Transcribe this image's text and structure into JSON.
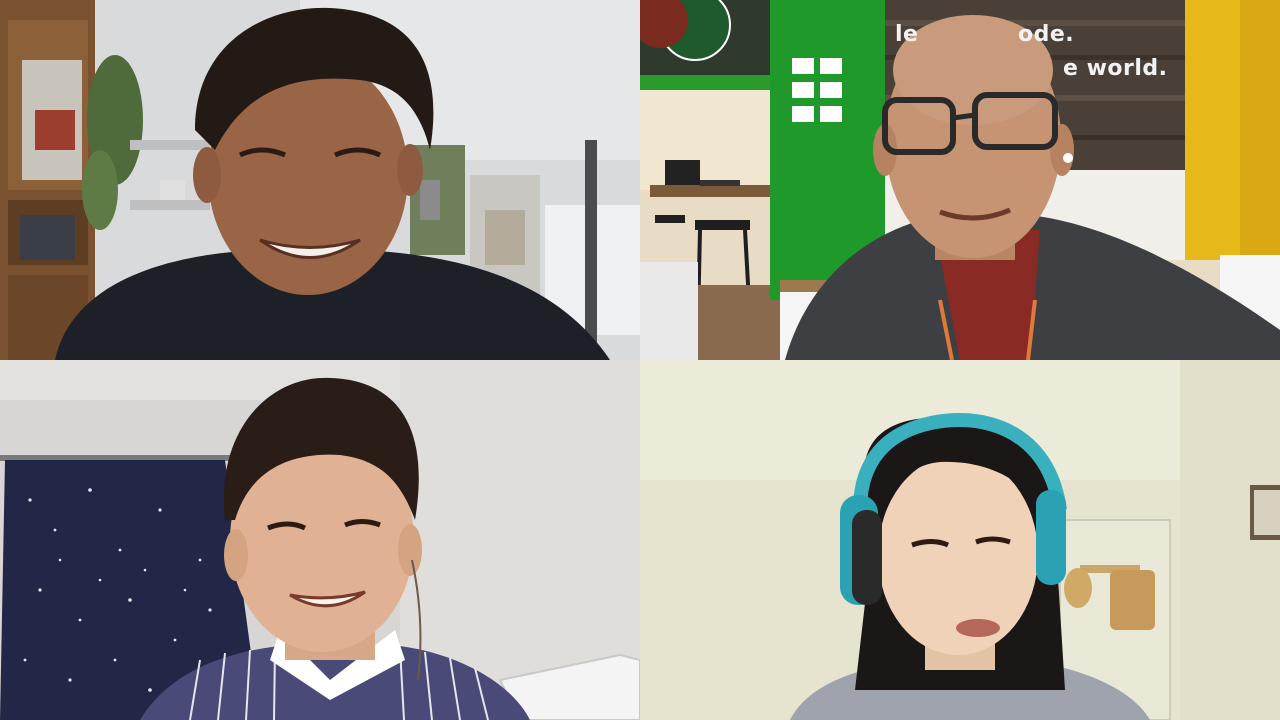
{
  "call": {
    "layout": "2x2 gallery view",
    "participants": [
      {
        "position": "top-left",
        "camera": "on"
      },
      {
        "position": "top-right",
        "camera": "on",
        "wall_text": [
          "le",
          "ode.",
          "e world."
        ]
      },
      {
        "position": "bottom-left",
        "camera": "on"
      },
      {
        "position": "bottom-right",
        "camera": "on"
      }
    ]
  }
}
